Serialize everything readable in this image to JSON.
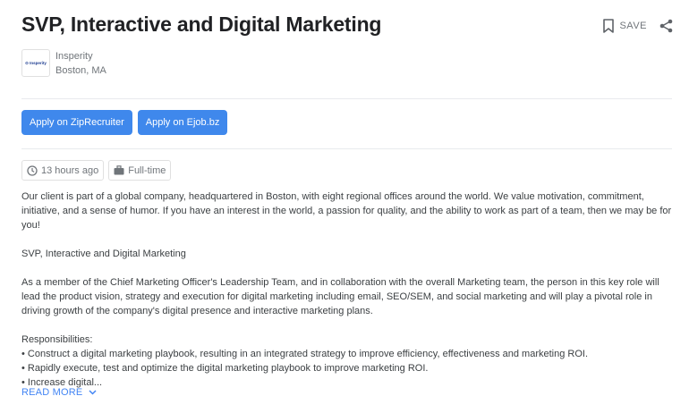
{
  "job": {
    "title": "SVP, Interactive and Digital Marketing",
    "save_label": "SAVE",
    "company": "Insperity",
    "location": "Boston, MA",
    "logo_text": "⊙ Insperity"
  },
  "apply_buttons": [
    {
      "label": "Apply on ZipRecruiter"
    },
    {
      "label": "Apply on Ejob.bz"
    }
  ],
  "chips": {
    "posted": "13 hours ago",
    "type": "Full-time"
  },
  "description": {
    "intro": "Our client is part of a global company, headquartered in Boston, with eight regional offices around the world. We value motivation, commitment, initiative, and a sense of humor. If you have an interest in the world, a passion for quality, and the ability to work as part of a team, then we may be for you!",
    "heading": "SVP, Interactive and Digital Marketing",
    "summary": "As a member of the Chief Marketing Officer's Leadership Team, and in collaboration with the overall Marketing team, the person in this key role will lead the product vision, strategy and execution for digital marketing including email, SEO/SEM, and social marketing and will play a pivotal role in driving growth of the company's digital presence and interactive marketing plans.",
    "responsibilities_heading": "Responsibilities:",
    "bullets": [
      "• Construct a digital marketing playbook, resulting in an integrated strategy to improve efficiency, effectiveness and marketing ROI.",
      "• Rapidly execute, test and optimize the digital marketing playbook to improve marketing ROI.",
      "• Increase digital..."
    ]
  },
  "read_more_label": "READ MORE",
  "icons": {
    "save": "bookmark-icon",
    "share": "share-icon",
    "posted": "clock-icon",
    "type": "briefcase-icon",
    "read_more": "chevron-down-icon"
  },
  "colors": {
    "accent": "#3f88ec",
    "link": "#4285f4"
  }
}
